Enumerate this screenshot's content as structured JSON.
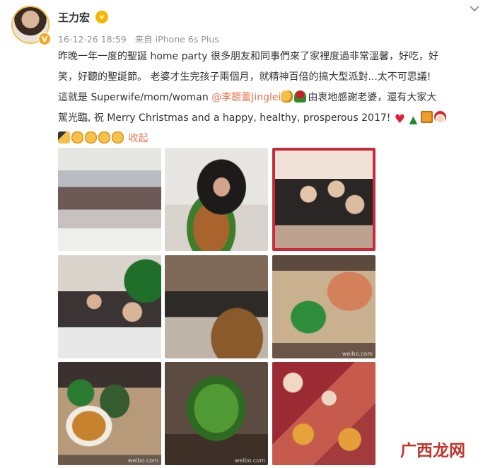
{
  "post": {
    "username": "王力宏",
    "vip_badge": "v",
    "avatar_badge": "V",
    "timestamp": "16-12-26 18:59",
    "source": "来自 iPhone 6s Plus",
    "text": {
      "line1": "昨晚一年一度的聖誕 home party 很多朋友和同事們來了家裡度過非常溫馨，好吃，好",
      "line2": "笑，好聽的聖誕節。 老婆才生完孩子兩個月，就精神百倍的搞大型派對...太不可思議!",
      "line3_before": "這就是 Superwife/mom/woman ",
      "mention": "@李靚蕾Jinglei",
      "line3_after": "由衷地感謝老婆，還有大家大",
      "line4": "駕光臨, 祝 Merry Christmas and a happy, healthy, prosperous 2017!",
      "collapse_label": "收起"
    },
    "emoji_line4": [
      "heart-emoji",
      "tree-emoji",
      "gift-emoji",
      "santa-emoji"
    ],
    "emoji_line5": [
      "party-emoji",
      "clap-emoji",
      "clap-emoji",
      "clap-emoji",
      "clap-emoji"
    ]
  },
  "photos": [
    {
      "name": "photo-group-party"
    },
    {
      "name": "photo-turkey"
    },
    {
      "name": "photo-friends-selfie"
    },
    {
      "name": "photo-group-christmas-tree"
    },
    {
      "name": "photo-buffet-table"
    },
    {
      "name": "photo-food-platter"
    },
    {
      "name": "photo-christmas-snacks"
    },
    {
      "name": "photo-broccoli-tree"
    },
    {
      "name": "photo-ham-rolls"
    }
  ],
  "photo_watermark": "weibo.com",
  "site_watermark": "广西龙网",
  "colors": {
    "link": "#eb7350",
    "meta": "#939393",
    "text": "#333333",
    "watermark": "#c0352c"
  }
}
